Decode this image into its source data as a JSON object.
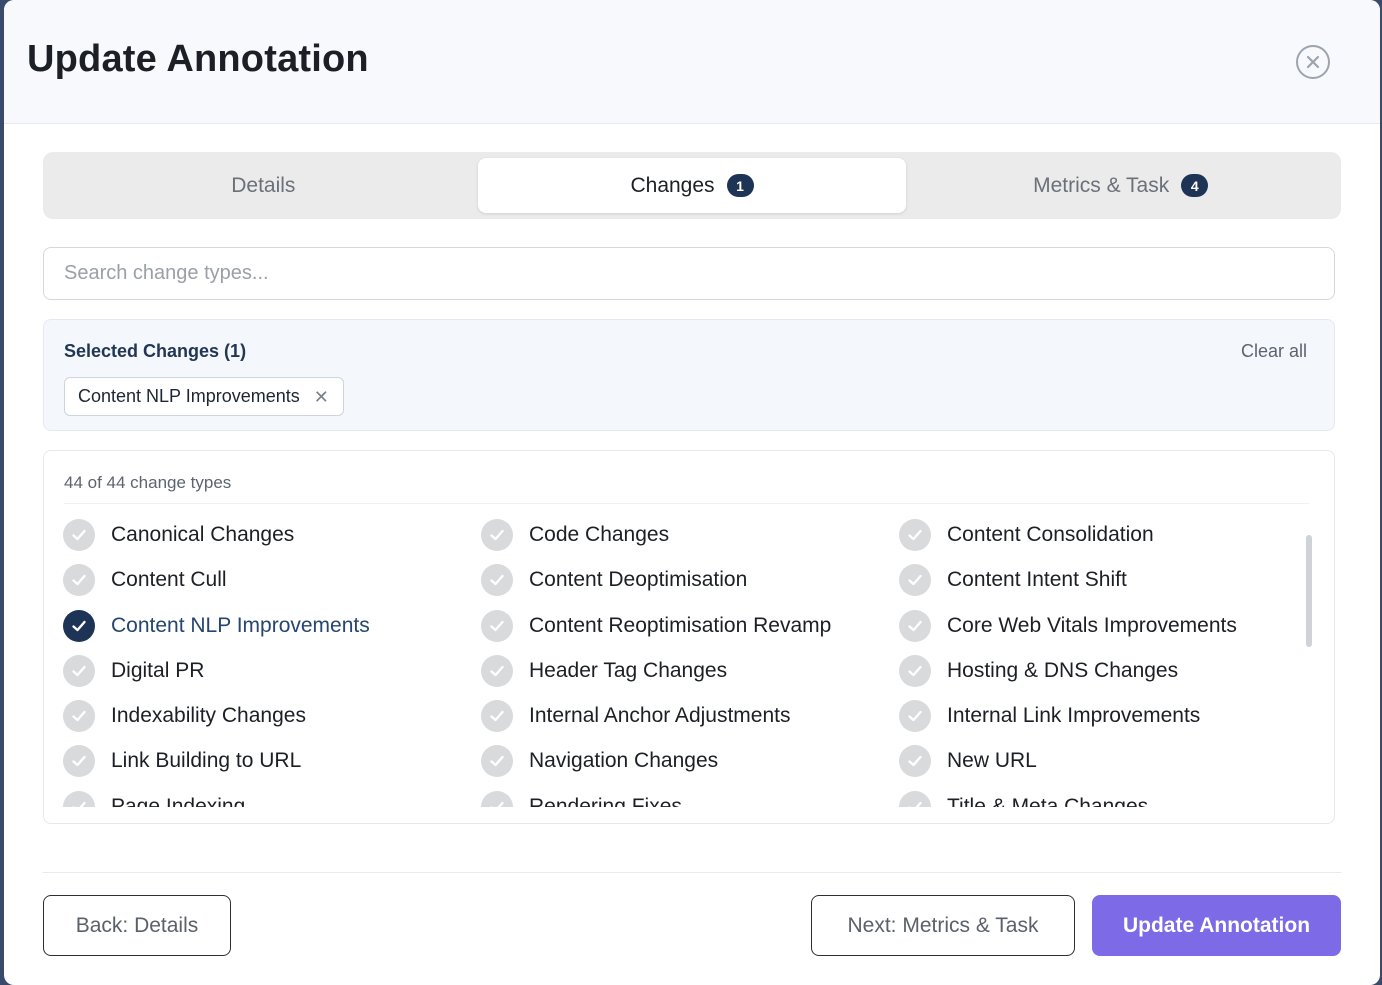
{
  "dialog": {
    "title": "Update Annotation"
  },
  "tabs": [
    {
      "label": "Details",
      "badge": null,
      "active": false
    },
    {
      "label": "Changes",
      "badge": "1",
      "active": true
    },
    {
      "label": "Metrics & Task",
      "badge": "4",
      "active": false
    }
  ],
  "search": {
    "placeholder": "Search change types...",
    "value": ""
  },
  "selected": {
    "title": "Selected Changes (1)",
    "clear_label": "Clear all",
    "chips": [
      "Content NLP Improvements"
    ]
  },
  "list": {
    "count_label": "44 of 44 change types",
    "items": [
      {
        "label": "Canonical Changes",
        "checked": false
      },
      {
        "label": "Code Changes",
        "checked": false
      },
      {
        "label": "Content Consolidation",
        "checked": false
      },
      {
        "label": "Content Cull",
        "checked": false
      },
      {
        "label": "Content Deoptimisation",
        "checked": false
      },
      {
        "label": "Content Intent Shift",
        "checked": false
      },
      {
        "label": "Content NLP Improvements",
        "checked": true
      },
      {
        "label": "Content Reoptimisation Revamp",
        "checked": false
      },
      {
        "label": "Core Web Vitals Improvements",
        "checked": false
      },
      {
        "label": "Digital PR",
        "checked": false
      },
      {
        "label": "Header Tag Changes",
        "checked": false
      },
      {
        "label": "Hosting & DNS Changes",
        "checked": false
      },
      {
        "label": "Indexability Changes",
        "checked": false
      },
      {
        "label": "Internal Anchor Adjustments",
        "checked": false
      },
      {
        "label": "Internal Link Improvements",
        "checked": false
      },
      {
        "label": "Link Building to URL",
        "checked": false
      },
      {
        "label": "Navigation Changes",
        "checked": false
      },
      {
        "label": "New URL",
        "checked": false
      },
      {
        "label": "Page Indexing",
        "checked": false
      },
      {
        "label": "Rendering Fixes",
        "checked": false
      },
      {
        "label": "Title & Meta Changes",
        "checked": false
      }
    ]
  },
  "footer": {
    "back_label": "Back: Details",
    "next_label": "Next: Metrics & Task",
    "submit_label": "Update Annotation"
  },
  "colors": {
    "accent": "#7c6ae6",
    "navy": "#1d3457",
    "check_off": "#d9dadc"
  }
}
